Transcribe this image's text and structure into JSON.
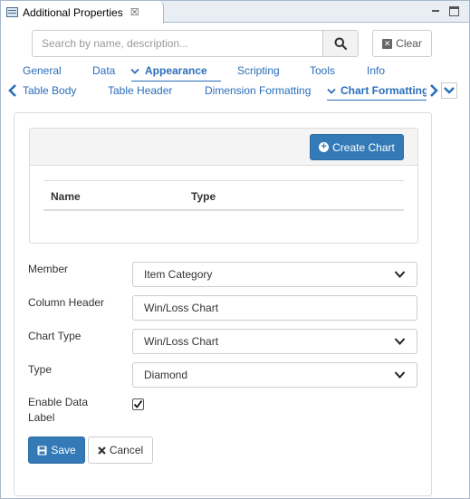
{
  "window": {
    "title": "Additional Properties",
    "close_glyph": "☒"
  },
  "search": {
    "placeholder": "Search by name, description...",
    "value": "",
    "clear_label": "Clear"
  },
  "tabs_primary": [
    {
      "label": "General",
      "active": false
    },
    {
      "label": "Data",
      "active": false
    },
    {
      "label": "Appearance",
      "active": true
    },
    {
      "label": "Scripting",
      "active": false
    },
    {
      "label": "Tools",
      "active": false
    },
    {
      "label": "Info",
      "active": false
    }
  ],
  "tabs_secondary": [
    {
      "label": "Table Body",
      "active": false
    },
    {
      "label": "Table Header",
      "active": false
    },
    {
      "label": "Dimension Formatting",
      "active": false
    },
    {
      "label": "Chart Formatting",
      "active": true
    }
  ],
  "chart_list": {
    "create_label": "Create Chart",
    "columns": [
      "Name",
      "Type"
    ],
    "rows": []
  },
  "form": {
    "member": {
      "label": "Member",
      "value": "Item Category"
    },
    "column_header": {
      "label": "Column Header",
      "value": "Win/Loss Chart"
    },
    "chart_type": {
      "label": "Chart Type",
      "value": "Win/Loss Chart"
    },
    "type": {
      "label": "Type",
      "value": "Diamond"
    },
    "enable_data_label": {
      "label_line1": "Enable Data",
      "label_line2": "Label",
      "checked": true
    }
  },
  "actions": {
    "save_label": "Save",
    "cancel_label": "Cancel"
  },
  "colors": {
    "primary": "#337ab7",
    "link": "#2a6ebb"
  }
}
